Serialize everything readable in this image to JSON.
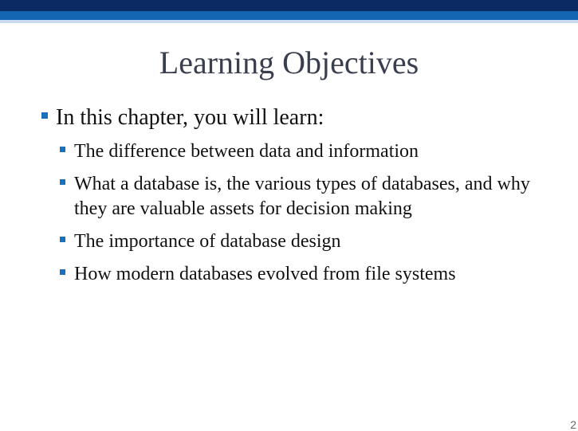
{
  "slide": {
    "title": "Learning Objectives",
    "main_bullet": "In this chapter, you will learn:",
    "sub_bullets": [
      "The difference between data and information",
      "What a database is, the various types of databases, and why they are valuable assets for decision making",
      "The importance of database design",
      "How modern databases evolved from file systems"
    ],
    "page_number": "2"
  },
  "colors": {
    "header_dark": "#0b2a63",
    "header_mid": "#1466b3",
    "header_light": "#c9dcef",
    "bullet": "#1b6fbf",
    "title_text": "#3a3f4f"
  }
}
